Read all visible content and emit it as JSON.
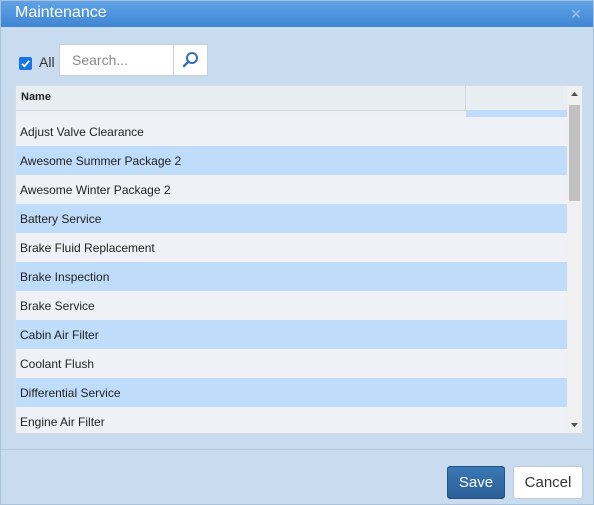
{
  "dialog": {
    "title": "Maintenance",
    "close_glyph": "×"
  },
  "toolbar": {
    "all_label": "All",
    "all_checked": true,
    "search_placeholder": "Search...",
    "search_value": ""
  },
  "grid": {
    "columns": [
      "Name",
      ""
    ],
    "rows": [
      "Adjust Valve Clearance",
      "Awesome Summer Package 2",
      "Awesome Winter Package 2",
      "Battery Service",
      "Brake Fluid Replacement",
      "Brake Inspection",
      "Brake Service",
      "Cabin Air Filter",
      "Coolant Flush",
      "Differential Service",
      "Engine Air Filter"
    ]
  },
  "footer": {
    "save_label": "Save",
    "cancel_label": "Cancel"
  },
  "colors": {
    "title_bar": "#4a8fdc",
    "row_highlight": "#c0dcfb",
    "row_plain": "#f0f1f6",
    "save_button": "#3268a1"
  },
  "icons": {
    "search": "magnifier-icon",
    "checkbox": "checkbox-checked-icon",
    "close": "close-icon",
    "scroll_up": "arrow-up-icon",
    "scroll_down": "arrow-down-icon"
  }
}
